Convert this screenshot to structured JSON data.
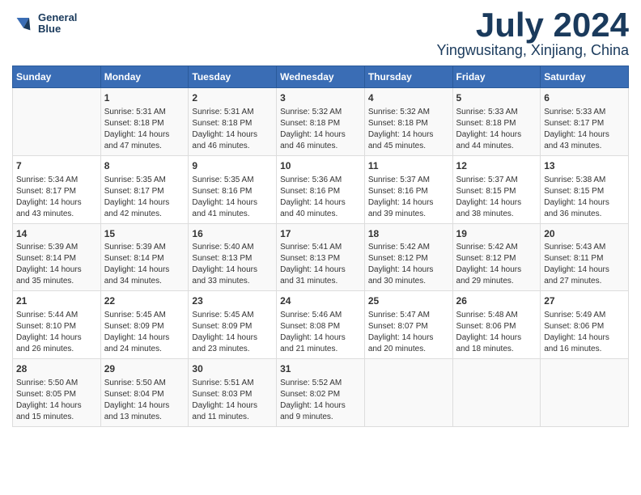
{
  "app": {
    "logo_line1": "General",
    "logo_line2": "Blue"
  },
  "title": "July 2024",
  "subtitle": "Yingwusitang, Xinjiang, China",
  "days_header": [
    "Sunday",
    "Monday",
    "Tuesday",
    "Wednesday",
    "Thursday",
    "Friday",
    "Saturday"
  ],
  "weeks": [
    [
      {
        "day": "",
        "content": ""
      },
      {
        "day": "1",
        "content": "Sunrise: 5:31 AM\nSunset: 8:18 PM\nDaylight: 14 hours\nand 47 minutes."
      },
      {
        "day": "2",
        "content": "Sunrise: 5:31 AM\nSunset: 8:18 PM\nDaylight: 14 hours\nand 46 minutes."
      },
      {
        "day": "3",
        "content": "Sunrise: 5:32 AM\nSunset: 8:18 PM\nDaylight: 14 hours\nand 46 minutes."
      },
      {
        "day": "4",
        "content": "Sunrise: 5:32 AM\nSunset: 8:18 PM\nDaylight: 14 hours\nand 45 minutes."
      },
      {
        "day": "5",
        "content": "Sunrise: 5:33 AM\nSunset: 8:18 PM\nDaylight: 14 hours\nand 44 minutes."
      },
      {
        "day": "6",
        "content": "Sunrise: 5:33 AM\nSunset: 8:17 PM\nDaylight: 14 hours\nand 43 minutes."
      }
    ],
    [
      {
        "day": "7",
        "content": "Sunrise: 5:34 AM\nSunset: 8:17 PM\nDaylight: 14 hours\nand 43 minutes."
      },
      {
        "day": "8",
        "content": "Sunrise: 5:35 AM\nSunset: 8:17 PM\nDaylight: 14 hours\nand 42 minutes."
      },
      {
        "day": "9",
        "content": "Sunrise: 5:35 AM\nSunset: 8:16 PM\nDaylight: 14 hours\nand 41 minutes."
      },
      {
        "day": "10",
        "content": "Sunrise: 5:36 AM\nSunset: 8:16 PM\nDaylight: 14 hours\nand 40 minutes."
      },
      {
        "day": "11",
        "content": "Sunrise: 5:37 AM\nSunset: 8:16 PM\nDaylight: 14 hours\nand 39 minutes."
      },
      {
        "day": "12",
        "content": "Sunrise: 5:37 AM\nSunset: 8:15 PM\nDaylight: 14 hours\nand 38 minutes."
      },
      {
        "day": "13",
        "content": "Sunrise: 5:38 AM\nSunset: 8:15 PM\nDaylight: 14 hours\nand 36 minutes."
      }
    ],
    [
      {
        "day": "14",
        "content": "Sunrise: 5:39 AM\nSunset: 8:14 PM\nDaylight: 14 hours\nand 35 minutes."
      },
      {
        "day": "15",
        "content": "Sunrise: 5:39 AM\nSunset: 8:14 PM\nDaylight: 14 hours\nand 34 minutes."
      },
      {
        "day": "16",
        "content": "Sunrise: 5:40 AM\nSunset: 8:13 PM\nDaylight: 14 hours\nand 33 minutes."
      },
      {
        "day": "17",
        "content": "Sunrise: 5:41 AM\nSunset: 8:13 PM\nDaylight: 14 hours\nand 31 minutes."
      },
      {
        "day": "18",
        "content": "Sunrise: 5:42 AM\nSunset: 8:12 PM\nDaylight: 14 hours\nand 30 minutes."
      },
      {
        "day": "19",
        "content": "Sunrise: 5:42 AM\nSunset: 8:12 PM\nDaylight: 14 hours\nand 29 minutes."
      },
      {
        "day": "20",
        "content": "Sunrise: 5:43 AM\nSunset: 8:11 PM\nDaylight: 14 hours\nand 27 minutes."
      }
    ],
    [
      {
        "day": "21",
        "content": "Sunrise: 5:44 AM\nSunset: 8:10 PM\nDaylight: 14 hours\nand 26 minutes."
      },
      {
        "day": "22",
        "content": "Sunrise: 5:45 AM\nSunset: 8:09 PM\nDaylight: 14 hours\nand 24 minutes."
      },
      {
        "day": "23",
        "content": "Sunrise: 5:45 AM\nSunset: 8:09 PM\nDaylight: 14 hours\nand 23 minutes."
      },
      {
        "day": "24",
        "content": "Sunrise: 5:46 AM\nSunset: 8:08 PM\nDaylight: 14 hours\nand 21 minutes."
      },
      {
        "day": "25",
        "content": "Sunrise: 5:47 AM\nSunset: 8:07 PM\nDaylight: 14 hours\nand 20 minutes."
      },
      {
        "day": "26",
        "content": "Sunrise: 5:48 AM\nSunset: 8:06 PM\nDaylight: 14 hours\nand 18 minutes."
      },
      {
        "day": "27",
        "content": "Sunrise: 5:49 AM\nSunset: 8:06 PM\nDaylight: 14 hours\nand 16 minutes."
      }
    ],
    [
      {
        "day": "28",
        "content": "Sunrise: 5:50 AM\nSunset: 8:05 PM\nDaylight: 14 hours\nand 15 minutes."
      },
      {
        "day": "29",
        "content": "Sunrise: 5:50 AM\nSunset: 8:04 PM\nDaylight: 14 hours\nand 13 minutes."
      },
      {
        "day": "30",
        "content": "Sunrise: 5:51 AM\nSunset: 8:03 PM\nDaylight: 14 hours\nand 11 minutes."
      },
      {
        "day": "31",
        "content": "Sunrise: 5:52 AM\nSunset: 8:02 PM\nDaylight: 14 hours\nand 9 minutes."
      },
      {
        "day": "",
        "content": ""
      },
      {
        "day": "",
        "content": ""
      },
      {
        "day": "",
        "content": ""
      }
    ]
  ]
}
